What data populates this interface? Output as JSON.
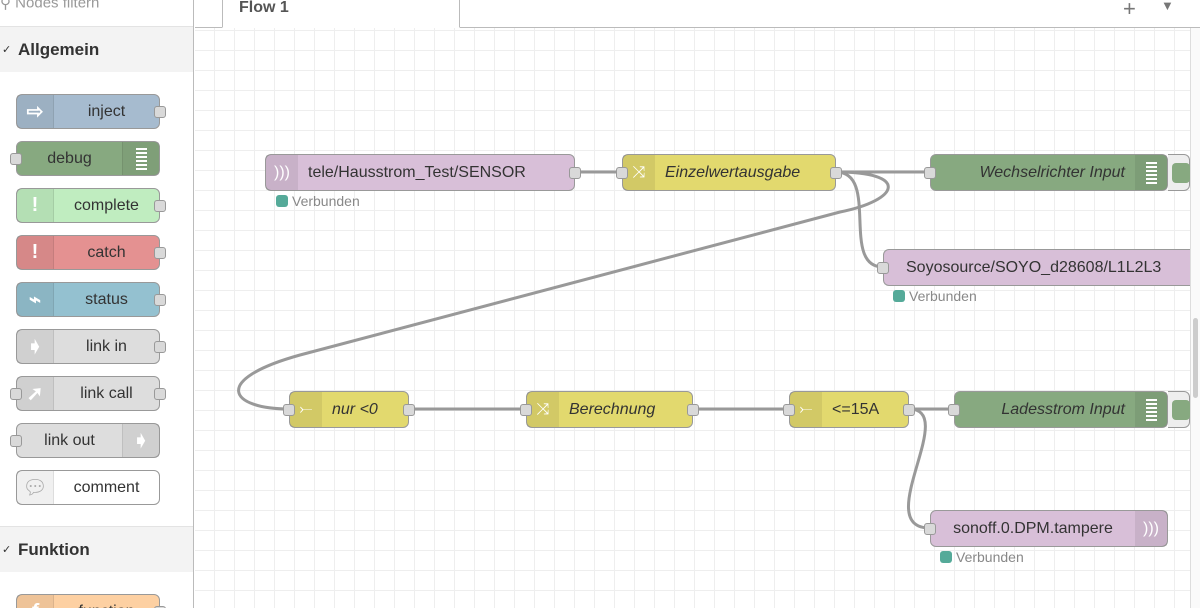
{
  "palette": {
    "filter_placeholder": "Nodes filtern",
    "categories": [
      {
        "label": "Allgemein"
      },
      {
        "label": "Funktion"
      }
    ],
    "nodes": [
      {
        "label": "inject",
        "color": "#a6bbcf",
        "icon": "arrow-right-icon"
      },
      {
        "label": "debug",
        "color": "#87a980",
        "icon": "list-icon"
      },
      {
        "label": "complete",
        "color": "#c0edc0",
        "icon": "exclamation-icon"
      },
      {
        "label": "catch",
        "color": "#e49191",
        "icon": "exclamation-icon"
      },
      {
        "label": "status",
        "color": "#94c1d0",
        "icon": "pulse-icon"
      },
      {
        "label": "link in",
        "color": "#dddddd",
        "icon": "link-in-icon"
      },
      {
        "label": "link call",
        "color": "#dddddd",
        "icon": "link-call-icon"
      },
      {
        "label": "link out",
        "color": "#dddddd",
        "icon": "link-out-icon"
      },
      {
        "label": "comment",
        "color": "#ffffff",
        "icon": "comment-icon"
      },
      {
        "label": "function",
        "color": "#fdd0a2",
        "icon": "function-icon"
      }
    ]
  },
  "tabs": [
    {
      "label": "Flow 1"
    }
  ],
  "flow": {
    "nodes": [
      {
        "label": "tele/Hausstrom_Test/SENSOR",
        "type": "mqtt in",
        "status": "Verbunden"
      },
      {
        "label": "Einzelwertausgabe",
        "type": "change"
      },
      {
        "label": "Wechselrichter Input",
        "type": "debug"
      },
      {
        "label": "Soyosource/SOYO_d28608/L1L2L3",
        "type": "mqtt out",
        "status": "Verbunden"
      },
      {
        "label": "nur <0",
        "type": "switch"
      },
      {
        "label": "Berechnung",
        "type": "change"
      },
      {
        "label": "<=15A",
        "type": "switch"
      },
      {
        "label": "Ladesstrom Input",
        "type": "debug"
      },
      {
        "label": "sonoff.0.DPM.tampere",
        "type": "mqtt out",
        "status": "Verbunden"
      }
    ]
  }
}
